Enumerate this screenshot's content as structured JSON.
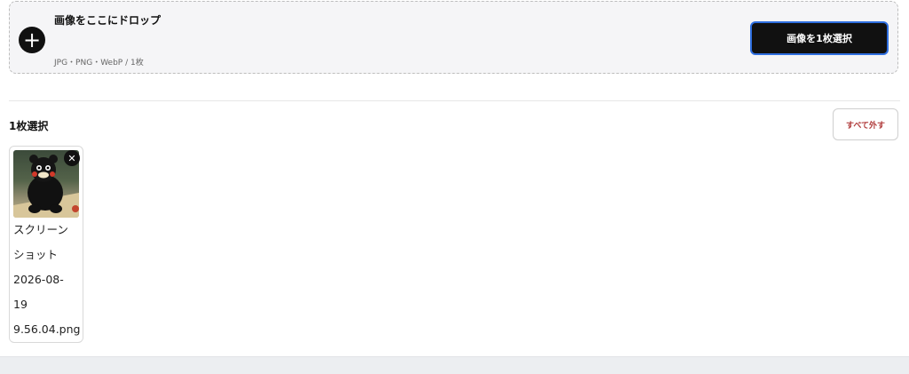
{
  "dropzone": {
    "title": "画像をここにドロップ",
    "formats": "JPG・PNG・WebP / 1枚",
    "select_button": "画像を1枚選択",
    "icon": "plus-icon"
  },
  "selection": {
    "count_label": "1枚選択",
    "clear_button": "すべて外す"
  },
  "files": [
    {
      "name_lines": [
        "スクリーン",
        "ショット",
        "2026-08-",
        "19",
        "9.56.04.png"
      ],
      "remove_icon": "close-icon"
    }
  ],
  "colors": {
    "primary_button": "#111111",
    "focus_ring": "#2f6fe0",
    "danger_text": "#b03a3a"
  }
}
